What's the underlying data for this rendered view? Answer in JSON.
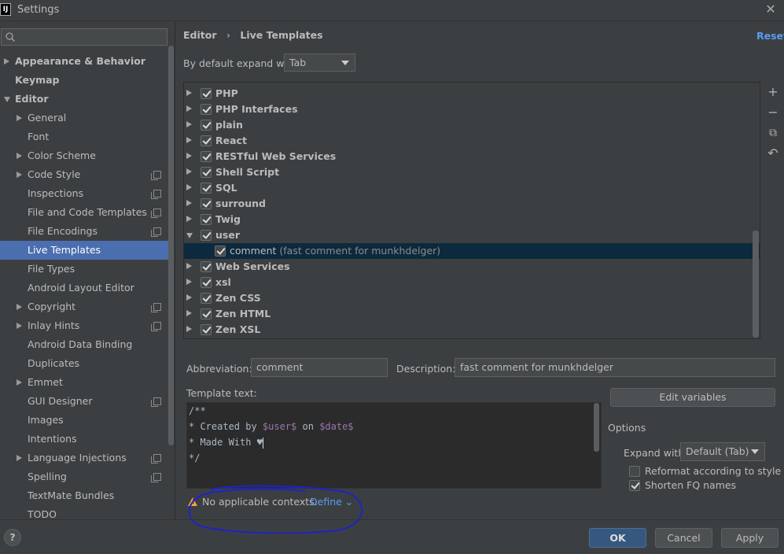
{
  "window": {
    "title": "Settings",
    "app_icon_text": "IJ",
    "close_glyph": "✕"
  },
  "search": {
    "placeholder": "",
    "value": ""
  },
  "sidebar": {
    "items": [
      {
        "label": "Appearance & Behavior",
        "arrow": "right",
        "bold": true
      },
      {
        "label": "Keymap",
        "bold": true
      },
      {
        "label": "Editor",
        "arrow": "down",
        "bold": true
      },
      {
        "label": "General",
        "arrow": "right"
      },
      {
        "label": "Font"
      },
      {
        "label": "Color Scheme",
        "arrow": "right"
      },
      {
        "label": "Code Style",
        "arrow": "right",
        "copy_icon": true
      },
      {
        "label": "Inspections",
        "copy_icon": true
      },
      {
        "label": "File and Code Templates",
        "copy_icon": true
      },
      {
        "label": "File Encodings",
        "copy_icon": true
      },
      {
        "label": "Live Templates",
        "selected": true
      },
      {
        "label": "File Types"
      },
      {
        "label": "Android Layout Editor"
      },
      {
        "label": "Copyright",
        "arrow": "right",
        "copy_icon": true
      },
      {
        "label": "Inlay Hints",
        "arrow": "right",
        "copy_icon": true
      },
      {
        "label": "Android Data Binding"
      },
      {
        "label": "Duplicates"
      },
      {
        "label": "Emmet",
        "arrow": "right"
      },
      {
        "label": "GUI Designer",
        "copy_icon": true
      },
      {
        "label": "Images"
      },
      {
        "label": "Intentions"
      },
      {
        "label": "Language Injections",
        "arrow": "right",
        "copy_icon": true
      },
      {
        "label": "Spelling",
        "copy_icon": true
      },
      {
        "label": "TextMate Bundles"
      },
      {
        "label": "TODO"
      }
    ]
  },
  "header": {
    "breadcrumb_parent": "Editor",
    "breadcrumb_sep": "›",
    "breadcrumb_current": "Live Templates",
    "reset_label": "Reset"
  },
  "expand_default": {
    "label": "By default expand with",
    "value": "Tab"
  },
  "template_groups": [
    {
      "label": "PHP",
      "checked": true,
      "expanded": false
    },
    {
      "label": "PHP Interfaces",
      "checked": true,
      "expanded": false
    },
    {
      "label": "plain",
      "checked": true,
      "expanded": false
    },
    {
      "label": "React",
      "checked": true,
      "expanded": false
    },
    {
      "label": "RESTful Web Services",
      "checked": true,
      "expanded": false
    },
    {
      "label": "Shell Script",
      "checked": true,
      "expanded": false
    },
    {
      "label": "SQL",
      "checked": true,
      "expanded": false
    },
    {
      "label": "surround",
      "checked": true,
      "expanded": false
    },
    {
      "label": "Twig",
      "checked": true,
      "expanded": false
    },
    {
      "label": "user",
      "checked": true,
      "expanded": true
    },
    {
      "label": "comment",
      "desc": "(fast comment for munkhdelger)",
      "checked": true,
      "child": true,
      "selected": true
    },
    {
      "label": "Web Services",
      "checked": true,
      "expanded": false
    },
    {
      "label": "xsl",
      "checked": true,
      "expanded": false
    },
    {
      "label": "Zen CSS",
      "checked": true,
      "expanded": false
    },
    {
      "label": "Zen HTML",
      "checked": true,
      "expanded": false
    },
    {
      "label": "Zen XSL",
      "checked": true,
      "expanded": false
    }
  ],
  "toolbar": {
    "add": "+",
    "remove": "−",
    "copy": "⧉",
    "restore": "↶"
  },
  "form": {
    "abbreviation_label": "Abbreviation:",
    "abbreviation_value": "comment",
    "description_label": "Description:",
    "description_value": "fast comment for munkhdelger",
    "template_text_label": "Template text:",
    "code": {
      "line1": "/**",
      "line2_pre": "* Created by ",
      "line2_var1": "$user$",
      "line2_mid": " on ",
      "line2_var2": "$date$",
      "line3": "* Made With ♥",
      "line4": "*/"
    },
    "edit_variables_label": "Edit variables",
    "options_label": "Options",
    "expand_with_label": "Expand with",
    "expand_with_value": "Default (Tab)",
    "reformat_label": "Reformat according to style",
    "reformat_checked": false,
    "shorten_label": "Shorten FQ names",
    "shorten_checked": true,
    "context_warning": "No applicable contexts.",
    "define_label": "Define ⌄"
  },
  "footer": {
    "help": "?",
    "ok": "OK",
    "cancel": "Cancel",
    "apply": "Apply"
  },
  "colors": {
    "accent": "#589df6",
    "selection": "#4b6eaf",
    "annotation_oval": "#1e22c9"
  }
}
